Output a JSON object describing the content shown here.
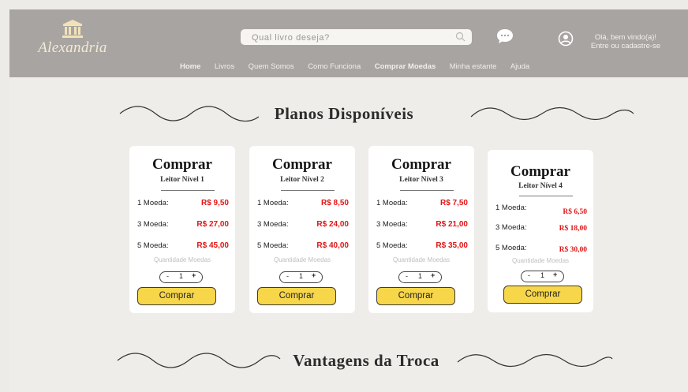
{
  "brand": {
    "name": "Alexandria"
  },
  "search": {
    "placeholder": "Qual livro deseja?"
  },
  "icons": {
    "search": "search-icon",
    "chat": "chat-bubble-icon",
    "user": "user-circle-icon",
    "logo": "temple-icon"
  },
  "account": {
    "greeting": "Olá, bem vindo(a)!",
    "cta": "Entre ou cadastre-se"
  },
  "nav": [
    "Home",
    "Livros",
    "Quem Somos",
    "Como Funciona",
    "Comprar Moedas",
    "Minha estante",
    "Ajuda"
  ],
  "sections": {
    "plans_title": "Planos Disponíveis",
    "advantages_title": "Vantagens da Troca"
  },
  "colors": {
    "header": "#a8a4a1",
    "price": "#e01616",
    "button": "#f7d64a",
    "background": "#eeedea"
  },
  "plans": [
    {
      "title": "Comprar",
      "level": "Leitor Nível 1",
      "rows": [
        {
          "label": "1 Moeda:",
          "price": "R$ 9,50"
        },
        {
          "label": "3 Moeda:",
          "price": "R$ 27,00"
        },
        {
          "label": "5 Moeda:",
          "price": "R$ 45,00"
        }
      ],
      "qty_label": "Quantidade Moedas",
      "qty": "1",
      "minus": "-",
      "plus": "+",
      "button": "Comprar"
    },
    {
      "title": "Comprar",
      "level": "Leitor Nível 2",
      "rows": [
        {
          "label": "1 Moeda:",
          "price": "R$ 8,50"
        },
        {
          "label": "3 Moeda:",
          "price": "R$ 24,00"
        },
        {
          "label": "5 Moeda:",
          "price": "R$ 40,00"
        }
      ],
      "qty_label": "Quantidade Moedas",
      "qty": "1",
      "minus": "-",
      "plus": "+",
      "button": "Comprar"
    },
    {
      "title": "Comprar",
      "level": "Leitor Nível 3",
      "rows": [
        {
          "label": "1 Moeda:",
          "price": "R$ 7,50"
        },
        {
          "label": "3 Moeda:",
          "price": "R$ 21,00"
        },
        {
          "label": "5 Moeda:",
          "price": "R$ 35,00"
        }
      ],
      "qty_label": "Quantidade Moedas",
      "qty": "1",
      "minus": "-",
      "plus": "+",
      "button": "Comprar"
    },
    {
      "title": "Comprar",
      "level": "Leitor Nível 4",
      "rows": [
        {
          "label": "1 Moeda:",
          "price": "R$ 6,50"
        },
        {
          "label": "3 Moeda:",
          "price": "R$ 18,00"
        },
        {
          "label": "5 Moeda:",
          "price": "R$ 30,00"
        }
      ],
      "qty_label": "Quantidade Moedas",
      "qty": "1",
      "minus": "-",
      "plus": "+",
      "button": "Comprar"
    }
  ]
}
